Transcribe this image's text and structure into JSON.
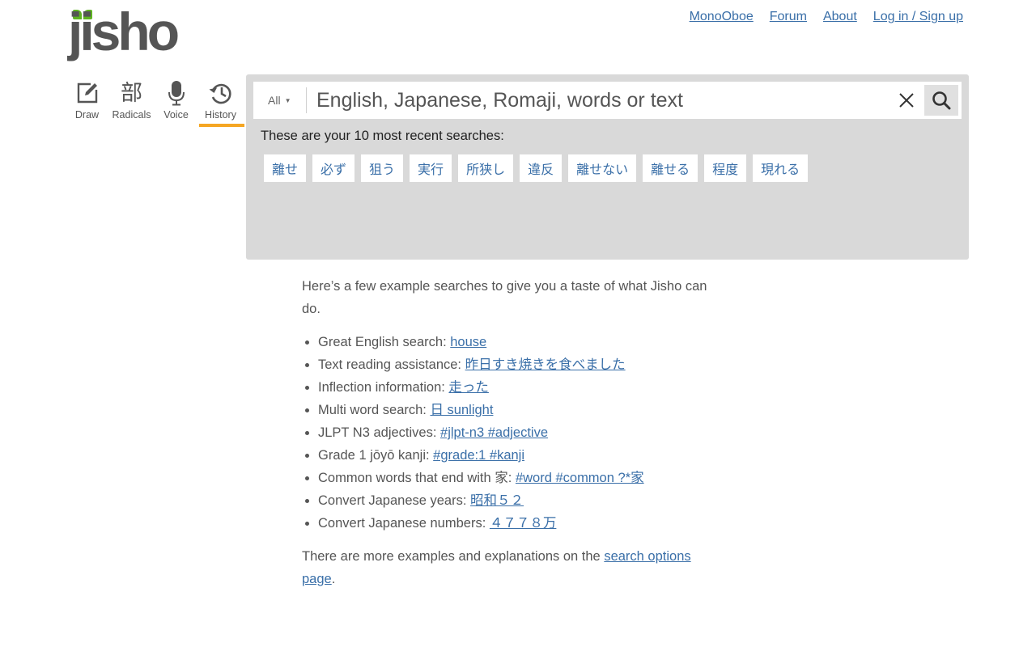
{
  "logo": {
    "text": "jisho",
    "leaf_color": "#5fb421"
  },
  "top_nav": [
    {
      "label": "MonoOboe"
    },
    {
      "label": "Forum"
    },
    {
      "label": "About"
    },
    {
      "label": "Log in / Sign up"
    }
  ],
  "input_methods": [
    {
      "label": "Draw",
      "icon": "draw-icon"
    },
    {
      "label": "Radicals",
      "icon": "radicals-icon",
      "glyph": "部"
    },
    {
      "label": "Voice",
      "icon": "microphone-icon"
    },
    {
      "label": "History",
      "icon": "history-icon",
      "active": true
    }
  ],
  "accent_color": "#f5a623",
  "search": {
    "filter": "All",
    "placeholder": "English, Japanese, Romaji, words or text"
  },
  "recent": {
    "label": "These are your 10 most recent searches:",
    "items": [
      "離せ",
      "必ず",
      "狙う",
      "実行",
      "所狭し",
      "違反",
      "離せない",
      "離せる",
      "程度",
      "現れる"
    ]
  },
  "examples": {
    "intro": "Here’s a few example searches to give you a taste of what Jisho can do.",
    "items": [
      {
        "text": "Great English search: ",
        "link": "house"
      },
      {
        "text": "Text reading assistance: ",
        "link": "昨日すき焼きを食べました"
      },
      {
        "text": "Inflection information: ",
        "link": "走った"
      },
      {
        "text": "Multi word search: ",
        "link": "日 sunlight"
      },
      {
        "text": "JLPT N3 adjectives: ",
        "link": "#jlpt-n3 #adjective"
      },
      {
        "text": "Grade 1 jōyō kanji: ",
        "link": "#grade:1 #kanji"
      },
      {
        "text": "Common words that end with 家: ",
        "link": "#word #common ?*家"
      },
      {
        "text": "Convert Japanese years: ",
        "link": "昭和５２"
      },
      {
        "text": "Convert Japanese numbers: ",
        "link": "４７７８万"
      }
    ],
    "outro_prefix": "There are more examples and explanations on the ",
    "outro_link": "search options page",
    "outro_suffix": "."
  }
}
